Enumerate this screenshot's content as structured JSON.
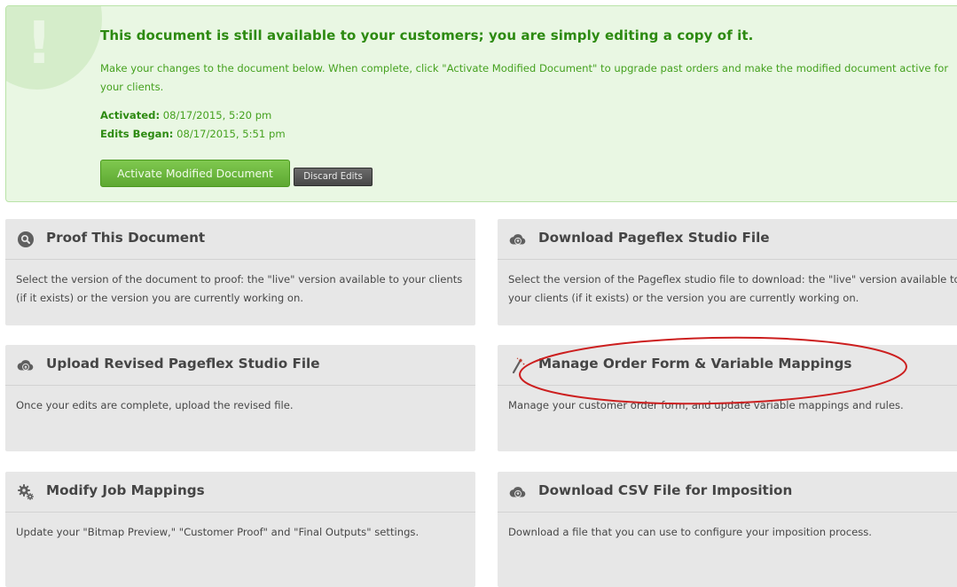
{
  "alert": {
    "icon": "exclamation-icon",
    "icon_glyph": "!",
    "title": "This document is still available to your customers; you are simply editing a copy of it.",
    "body": "Make your changes to the document below. When complete, click \"Activate Modified Document\" to upgrade past orders and make the modified document active for your clients.",
    "activated_label": "Activated:",
    "activated_value": " 08/17/2015, 5:20 pm",
    "edits_began_label": "Edits Began:",
    "edits_began_value": " 08/17/2015, 5:51 pm",
    "activate_button": "Activate Modified Document",
    "discard_button": "Discard Edits",
    "colors": {
      "background": "#e9f7e3",
      "text": "#45a11f",
      "title": "#2c8a10"
    }
  },
  "cards": {
    "proof": {
      "icon": "magnifier-icon",
      "title": "Proof This Document",
      "description": "Select the version of the document to proof: the \"live\" version available to your clients (if it exists) or the version you are currently working on."
    },
    "download_studio": {
      "icon": "cloud-download-icon",
      "title": "Download Pageflex Studio File",
      "description": "Select the version of the Pageflex studio file to download: the \"live\" version available to your clients (if it exists) or the version you are currently working on."
    },
    "upload_revised": {
      "icon": "cloud-upload-icon",
      "title": "Upload Revised Pageflex Studio File",
      "description": "Once your edits are complete, upload the revised file."
    },
    "manage_order_form": {
      "icon": "magic-wand-icon",
      "title": "Manage Order Form & Variable Mappings",
      "description": "Manage your customer order form, and update variable mappings and rules."
    },
    "job_mappings": {
      "icon": "gears-icon",
      "title": "Modify Job Mappings",
      "description": "Update your \"Bitmap Preview,\" \"Customer Proof\" and \"Final Outputs\" settings."
    },
    "download_csv": {
      "icon": "cloud-download-icon",
      "title": "Download CSV File for Imposition",
      "description": "Download a file that you can use to configure your imposition process."
    }
  },
  "annotation": {
    "shape": "ellipse",
    "color": "#cc1f1f"
  }
}
